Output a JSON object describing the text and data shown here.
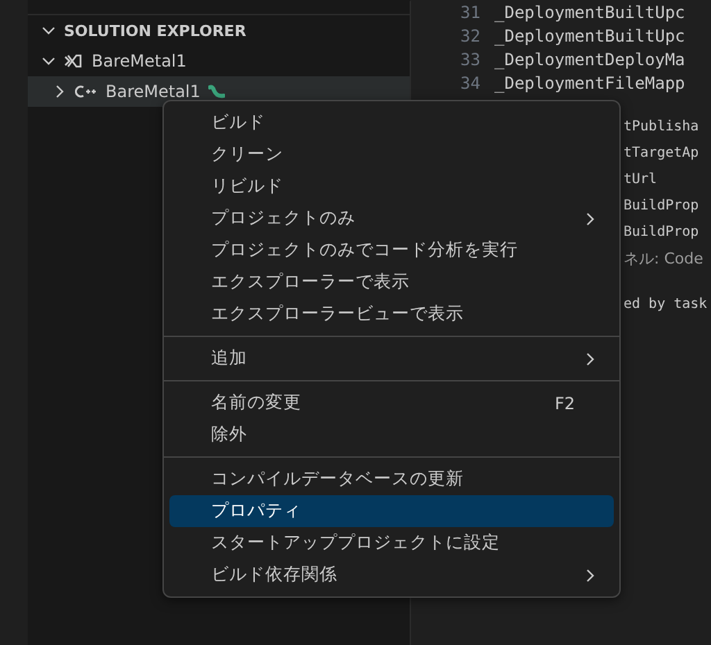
{
  "sidebar": {
    "header": "SOLUTION EXPLORER",
    "tree": [
      {
        "label": "BareMetal1",
        "kind": "solution",
        "expanded": true,
        "selected": false,
        "children": [
          {
            "label": "BareMetal1",
            "kind": "project",
            "expanded": false,
            "selected": true,
            "startup": true
          }
        ]
      }
    ]
  },
  "editor": {
    "lines": [
      {
        "number": "31",
        "text": "_DeploymentBuiltUpc"
      },
      {
        "number": "32",
        "text": "_DeploymentBuiltUpc"
      },
      {
        "number": "33",
        "text": "_DeploymentDeployMa"
      },
      {
        "number": "34",
        "text": "_DeploymentFileMapp"
      }
    ],
    "fragments": [
      {
        "text": "tPublisha",
        "kind": "code"
      },
      {
        "text": "tTargetAp",
        "kind": "code"
      },
      {
        "text": "tUrl",
        "kind": "code"
      },
      {
        "text": "BuildProp",
        "kind": "code"
      },
      {
        "text": "BuildProp",
        "kind": "code"
      },
      {
        "text": "ネル: Code",
        "kind": "panel"
      },
      {
        "text": "ed by task",
        "kind": "code"
      }
    ]
  },
  "context_menu": [
    {
      "kind": "item",
      "label": "ビルド",
      "submenu": false,
      "selected": false
    },
    {
      "kind": "item",
      "label": "クリーン",
      "submenu": false,
      "selected": false
    },
    {
      "kind": "item",
      "label": "リビルド",
      "submenu": false,
      "selected": false
    },
    {
      "kind": "item",
      "label": "プロジェクトのみ",
      "submenu": true,
      "selected": false
    },
    {
      "kind": "item",
      "label": "プロジェクトのみでコード分析を実行",
      "submenu": false,
      "selected": false
    },
    {
      "kind": "item",
      "label": "エクスプローラーで表示",
      "submenu": false,
      "selected": false
    },
    {
      "kind": "item",
      "label": "エクスプローラービューで表示",
      "submenu": false,
      "selected": false
    },
    {
      "kind": "separator"
    },
    {
      "kind": "item",
      "label": "追加",
      "submenu": true,
      "selected": false
    },
    {
      "kind": "separator"
    },
    {
      "kind": "item",
      "label": "名前の変更",
      "shortcut": "F2",
      "submenu": false,
      "selected": false
    },
    {
      "kind": "item",
      "label": "除外",
      "submenu": false,
      "selected": false
    },
    {
      "kind": "separator"
    },
    {
      "kind": "item",
      "label": "コンパイルデータベースの更新",
      "submenu": false,
      "selected": false
    },
    {
      "kind": "item",
      "label": "プロパティ",
      "submenu": false,
      "selected": true
    },
    {
      "kind": "item",
      "label": "スタートアッププロジェクトに設定",
      "submenu": false,
      "selected": false
    },
    {
      "kind": "item",
      "label": "ビルド依存関係",
      "submenu": true,
      "selected": false
    }
  ]
}
